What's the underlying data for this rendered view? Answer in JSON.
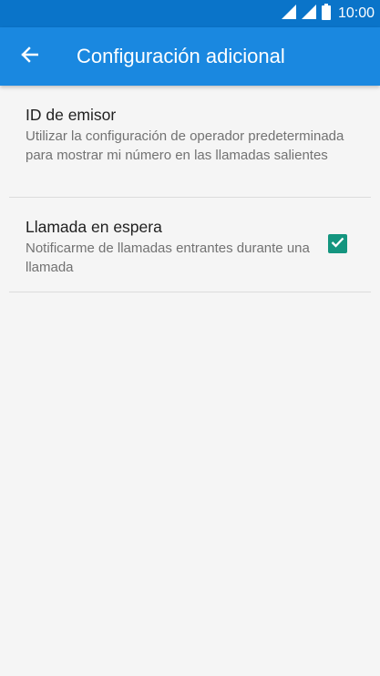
{
  "status_bar": {
    "time": "10:00",
    "icons": [
      "wifi-signal-icon",
      "cell-signal-icon",
      "battery-icon"
    ]
  },
  "app_bar": {
    "back_icon": "arrow-back-icon",
    "title": "Configuración adicional"
  },
  "settings": {
    "items": [
      {
        "label": "ID de emisor",
        "description": "Utilizar la configuración de operador predeterminada para mostrar mi número en las llamadas salientes"
      },
      {
        "label": "Llamada en espera",
        "description": "Notificarme de llamadas entrantes durante una llamada",
        "checked": true
      }
    ]
  },
  "colors": {
    "status_bar": "#0a74c9",
    "app_bar": "#1a88e0",
    "checkbox": "#14957f",
    "background": "#f5f5f5"
  }
}
